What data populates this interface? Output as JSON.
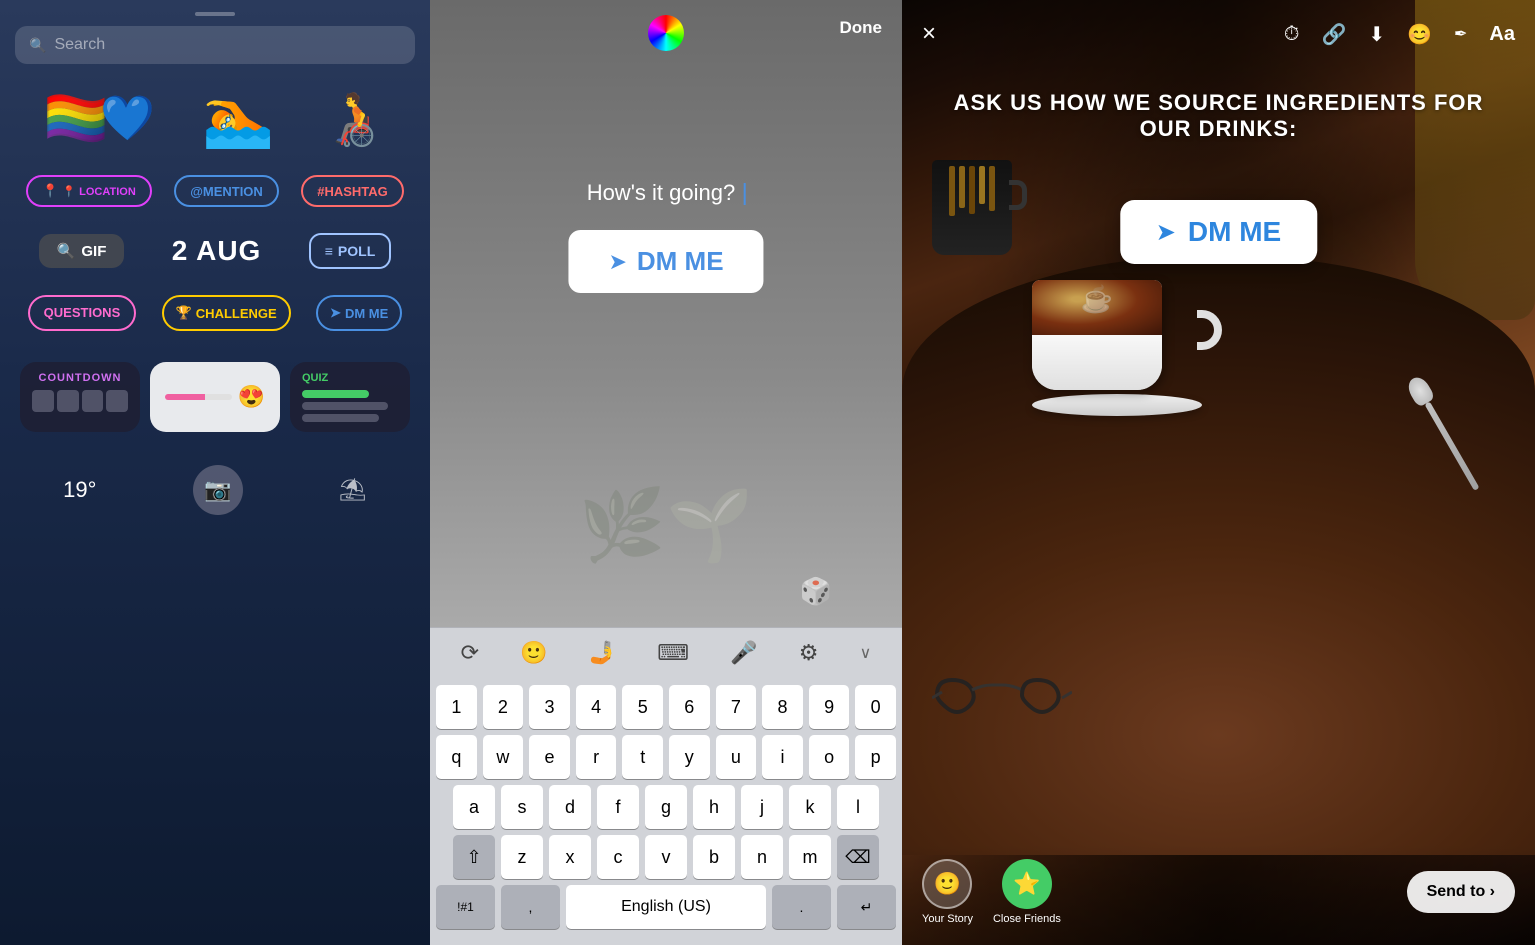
{
  "panel1": {
    "search_placeholder": "Search",
    "stickers": [
      "🏳️‍🌈❤️",
      "🏊",
      "♿🏀"
    ],
    "tags": [
      {
        "label": "📍 LOCATION",
        "type": "location"
      },
      {
        "label": "@MENTION",
        "type": "mention"
      },
      {
        "label": "#HASHTAG",
        "type": "hashtag"
      }
    ],
    "tools": [
      {
        "label": "🔍 GIF",
        "type": "gif"
      },
      {
        "label": "2 AUG",
        "type": "date"
      },
      {
        "label": "≡ POLL",
        "type": "poll"
      }
    ],
    "sticker_btns": [
      {
        "label": "QUESTIONS",
        "type": "questions"
      },
      {
        "label": "🏆 CHALLENGE",
        "type": "challenge"
      },
      {
        "label": "➤ DM ME",
        "type": "dm"
      }
    ],
    "widgets": [
      {
        "type": "countdown",
        "label": "COUNTDOWN"
      },
      {
        "type": "slider",
        "emoji": "😍"
      },
      {
        "type": "quiz",
        "label": "QUIZ"
      }
    ],
    "bottom_items": [
      {
        "label": "19°",
        "type": "temp"
      },
      {
        "label": "📷",
        "type": "camera"
      },
      {
        "label": "⛱",
        "type": "panorama"
      }
    ]
  },
  "panel2": {
    "color_wheel": "color wheel",
    "done_label": "Done",
    "typed_text": "How's it going?",
    "dm_btn_label": "DM ME",
    "dm_btn_icon": "➤",
    "plant_emoji": "🌿",
    "dice_emoji": "🎲",
    "keyboard": {
      "toolbar_icons": [
        "↕",
        "😊",
        "🤳",
        "⌨",
        "🎤",
        "⚙",
        "∨"
      ],
      "rows": [
        [
          "1",
          "2",
          "3",
          "4",
          "5",
          "6",
          "7",
          "8",
          "9",
          "0"
        ],
        [
          "q",
          "w",
          "e",
          "r",
          "t",
          "y",
          "u",
          "i",
          "o",
          "p"
        ],
        [
          "a",
          "s",
          "d",
          "f",
          "g",
          "h",
          "j",
          "k",
          "l"
        ],
        [
          "⇧",
          "z",
          "x",
          "c",
          "v",
          "b",
          "n",
          "m",
          "⌫"
        ],
        [
          "!#1",
          ",",
          "English (US)",
          ".",
          "↵"
        ]
      ]
    }
  },
  "panel3": {
    "close_icon": "×",
    "top_icons": [
      "⟳",
      "🔗",
      "⬇",
      "😊",
      "✏",
      "Aa"
    ],
    "title": "ASK US HOW WE SOURCE INGREDIENTS FOR OUR DRINKS:",
    "dm_btn_label": "DM ME",
    "dm_btn_icon": "➤",
    "bottom": {
      "your_story_label": "Your Story",
      "close_friends_label": "Close Friends",
      "send_to_label": "Send to ›"
    }
  }
}
